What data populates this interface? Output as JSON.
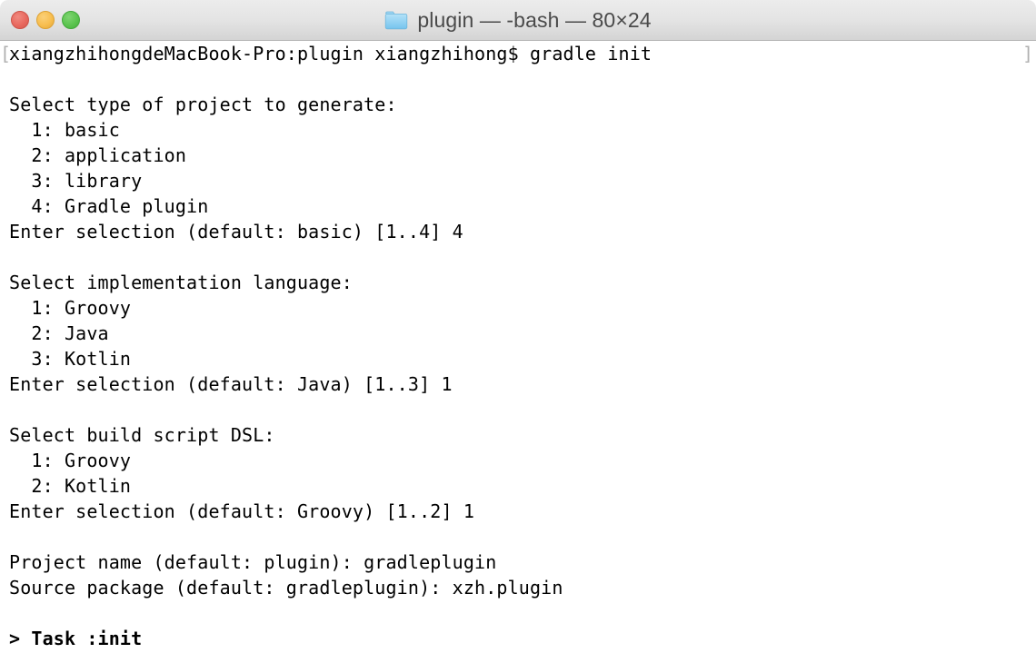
{
  "window": {
    "title": "plugin — -bash — 80×24",
    "folder_icon": "folder-icon",
    "traffic_lights": [
      {
        "name": "close",
        "color": "#e8695f"
      },
      {
        "name": "minimize",
        "color": "#f7be4f"
      },
      {
        "name": "maximize",
        "color": "#5bc44f"
      }
    ]
  },
  "terminal": {
    "columns": 80,
    "rows": 24,
    "edge_marker_left": "[",
    "edge_marker_right": "]",
    "prompt_line": "xiangzhihongdeMacBook-Pro:plugin xiangzhihong$ gradle init",
    "lines": [
      {
        "text": "xiangzhihongdeMacBook-Pro:plugin xiangzhihong$ gradle init",
        "bold": false
      },
      {
        "text": "",
        "bold": false
      },
      {
        "text": "Select type of project to generate:",
        "bold": false
      },
      {
        "text": "  1: basic",
        "bold": false
      },
      {
        "text": "  2: application",
        "bold": false
      },
      {
        "text": "  3: library",
        "bold": false
      },
      {
        "text": "  4: Gradle plugin",
        "bold": false
      },
      {
        "text": "Enter selection (default: basic) [1..4] 4",
        "bold": false
      },
      {
        "text": "",
        "bold": false
      },
      {
        "text": "Select implementation language:",
        "bold": false
      },
      {
        "text": "  1: Groovy",
        "bold": false
      },
      {
        "text": "  2: Java",
        "bold": false
      },
      {
        "text": "  3: Kotlin",
        "bold": false
      },
      {
        "text": "Enter selection (default: Java) [1..3] 1",
        "bold": false
      },
      {
        "text": "",
        "bold": false
      },
      {
        "text": "Select build script DSL:",
        "bold": false
      },
      {
        "text": "  1: Groovy",
        "bold": false
      },
      {
        "text": "  2: Kotlin",
        "bold": false
      },
      {
        "text": "Enter selection (default: Groovy) [1..2] 1",
        "bold": false
      },
      {
        "text": "",
        "bold": false
      },
      {
        "text": "Project name (default: plugin): gradleplugin",
        "bold": false
      },
      {
        "text": "Source package (default: gradleplugin): xzh.plugin",
        "bold": false
      },
      {
        "text": "",
        "bold": false
      },
      {
        "text": "> Task :init",
        "bold": true
      }
    ]
  }
}
